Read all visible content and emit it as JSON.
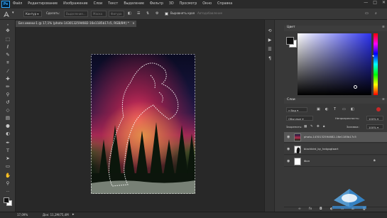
{
  "menubar": {
    "logo": "Ps",
    "items": [
      "Файл",
      "Редактирование",
      "Изображение",
      "Слои",
      "Текст",
      "Выделение",
      "Фильтр",
      "3D",
      "Просмотр",
      "Окно",
      "Справка"
    ],
    "window_controls": [
      "—",
      "□",
      "✕"
    ]
  },
  "options": {
    "mode": "Контур",
    "mode_label": "Сделать:",
    "selection_btn": "Выделение...",
    "mask_btn": "Маска",
    "shape_btn": "Фигура",
    "align_edges": "Выровнять края",
    "autoadd": "Автодобавление"
  },
  "document": {
    "tab_title": "Без имени-1 @ 17,1% (photo-1430132594682-16e1185b17c5, RGB/8#) *",
    "tab_close": "×",
    "zoom": "17,09%",
    "doc_size": "Док: 11,2М/75,4М"
  },
  "color_panel": {
    "title": "Цвет",
    "fg": "#111111",
    "bg": "#ffffff",
    "hue": "#2c32ee"
  },
  "layers_panel": {
    "title": "Слои",
    "filter_label": "Вид",
    "blend_mode": "Обычные",
    "opacity_label": "Непрозрачность:",
    "opacity_value": "100%",
    "lock_label": "Закрепить:",
    "fill_label": "Заливка:",
    "fill_value": "100%",
    "layers": [
      {
        "name": "photo-1430132594682-16e1185b17c5",
        "selected": true,
        "thumb": "photo"
      },
      {
        "name": "blackbird_by_hatgogtaart",
        "selected": false,
        "thumb": "bird"
      },
      {
        "name": "Фон",
        "selected": false,
        "thumb": "white",
        "locked": true
      }
    ]
  },
  "toolbar": {
    "tools": [
      "move-tool",
      "marquee-tool",
      "lasso-tool",
      "quick-select-tool",
      "crop-tool",
      "eyedropper-tool",
      "healing-tool",
      "brush-tool",
      "clone-stamp-tool",
      "history-brush-tool",
      "eraser-tool",
      "gradient-tool",
      "blur-tool",
      "dodge-tool",
      "pen-tool",
      "type-tool",
      "path-select-tool",
      "shape-tool",
      "hand-tool",
      "zoom-tool"
    ]
  }
}
